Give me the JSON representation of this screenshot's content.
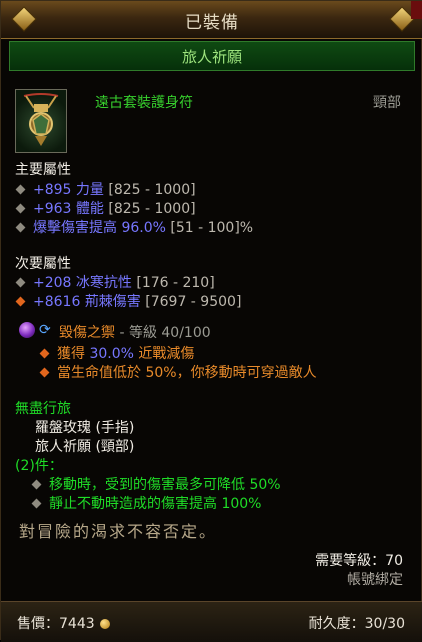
{
  "header": {
    "status": "已裝備"
  },
  "set_banner": {
    "name": "旅人祈願"
  },
  "item": {
    "name": "遠古套裝護身符",
    "slot": "頸部",
    "icon": "amulet-icon"
  },
  "primary": {
    "heading": "主要屬性",
    "stats": [
      {
        "value": "+895",
        "name": "力量",
        "range": "[825 - 1000]"
      },
      {
        "value": "+963",
        "name": "體能",
        "range": "[825 - 1000]"
      },
      {
        "value": "爆擊傷害提高 96.0%",
        "name": "",
        "range": "[51 - 100]%"
      }
    ]
  },
  "secondary": {
    "heading": "次要屬性",
    "stats": [
      {
        "value": "+208",
        "name": "冰寒抗性",
        "range": "[176 - 210]"
      },
      {
        "value": "+8616",
        "name": "荊棘傷害",
        "range": "[7697 - 9500]"
      }
    ]
  },
  "gem": {
    "name": "毀傷之禦",
    "level_text": "- 等級 40/100",
    "effects": [
      {
        "prefix": "獲得 ",
        "value": "30.0%",
        "suffix": " 近戰減傷"
      },
      {
        "text": "當生命值低於 50%，你移動時可穿過敵人"
      }
    ]
  },
  "set_bonus": {
    "title": "無盡行旅",
    "pieces": [
      "羅盤玫瑰 (手指)",
      "旅人祈願 (頸部)"
    ],
    "count_label": "(2)件：",
    "bonuses": [
      "移動時，受到的傷害最多可降低 50%",
      "靜止不動時造成的傷害提高 100%"
    ]
  },
  "flavor_text": "對冒險的渴求不容否定。",
  "requirements": {
    "level": "需要等級：70",
    "binding": "帳號綁定"
  },
  "footer": {
    "sell_label": "售價：7443",
    "durability_label": "耐久度：30/30"
  },
  "colors": {
    "set_green": "#37d12e",
    "magic_blue": "#7777ff",
    "legendary_orange": "#e88a2a",
    "bonus_green": "#1fdc27"
  }
}
